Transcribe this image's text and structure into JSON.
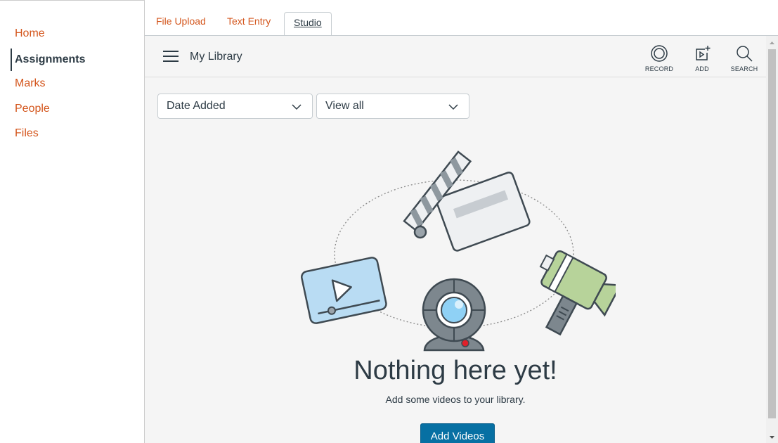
{
  "sidebar": {
    "items": [
      {
        "label": "Home"
      },
      {
        "label": "Assignments"
      },
      {
        "label": "Marks"
      },
      {
        "label": "People"
      },
      {
        "label": "Files"
      }
    ],
    "active_index": 1
  },
  "tabs": [
    {
      "label": "File Upload"
    },
    {
      "label": "Text Entry"
    },
    {
      "label": "Studio"
    }
  ],
  "active_tab": "Studio",
  "studio": {
    "title": "My Library",
    "tools": {
      "record": "RECORD",
      "add": "ADD",
      "search": "SEARCH"
    },
    "sort_select": "Date Added",
    "filter_select": "View all",
    "empty_title": "Nothing here yet!",
    "empty_subtitle": "Add some videos to your library.",
    "add_button": "Add Videos"
  },
  "colors": {
    "link": "#d4571e",
    "primary_button": "#0770a3",
    "text": "#2d3b45",
    "panel_bg": "#f5f5f5"
  }
}
